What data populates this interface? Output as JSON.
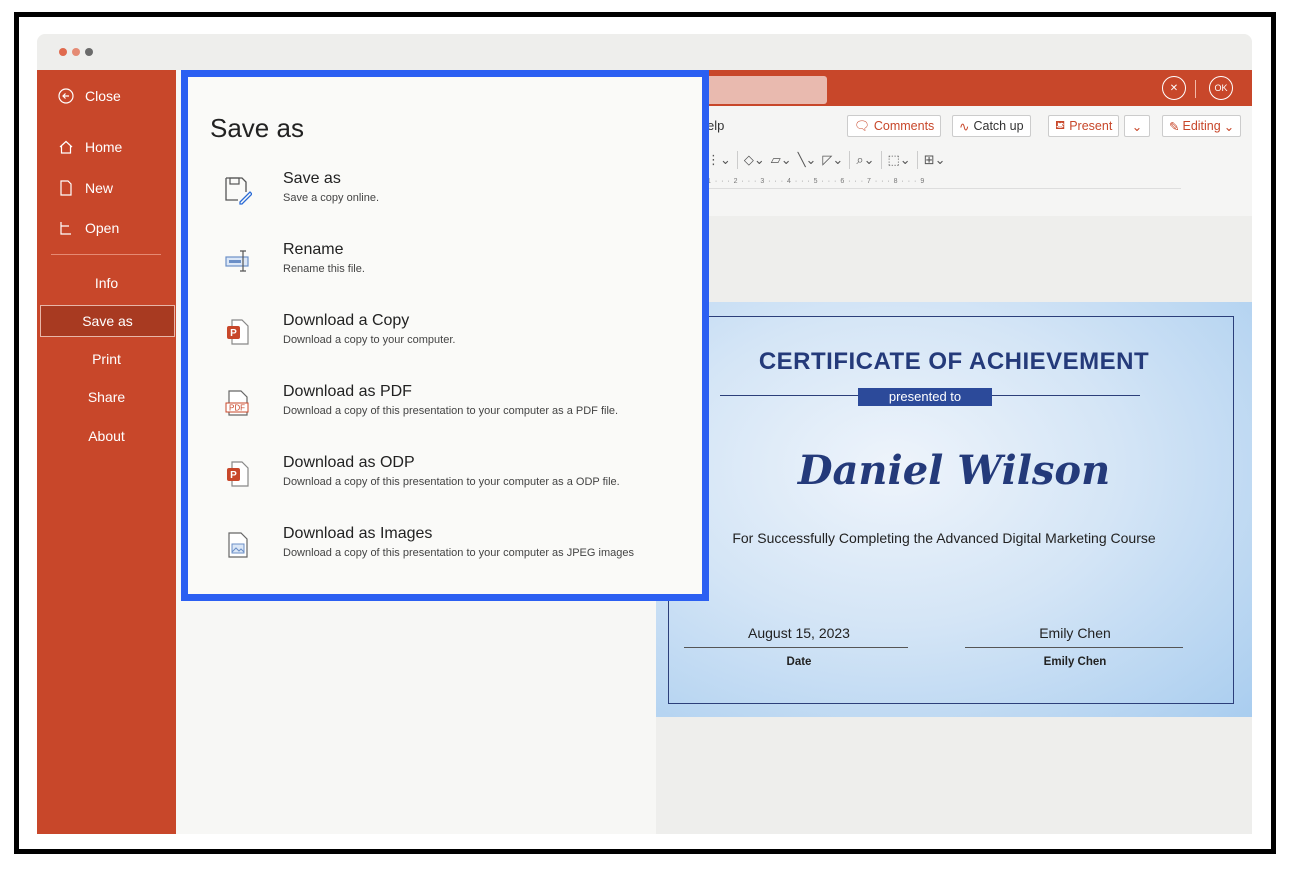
{
  "colors": {
    "accent": "#c8472a",
    "active": "#a83a21",
    "highlight": "#2b5ff2",
    "cert_blue": "#243a7a"
  },
  "sidebar": {
    "items": [
      {
        "label": "Close",
        "icon": "back-arrow-icon"
      },
      {
        "label": "Home",
        "icon": "home-icon"
      },
      {
        "label": "New",
        "icon": "new-file-icon"
      },
      {
        "label": "Open",
        "icon": "open-folder-icon"
      },
      {
        "label": "Info"
      },
      {
        "label": "Save as",
        "active": true
      },
      {
        "label": "Print"
      },
      {
        "label": "Share"
      },
      {
        "label": "About"
      }
    ]
  },
  "save_panel": {
    "title": "Save as",
    "options": [
      {
        "title": "Save as",
        "desc": "Save a copy online.",
        "icon": "save-as-icon"
      },
      {
        "title": "Rename",
        "desc": "Rename this file.",
        "icon": "rename-icon"
      },
      {
        "title": "Download a Copy",
        "desc": "Download a copy to your computer.",
        "icon": "powerpoint-file-icon"
      },
      {
        "title": "Download as PDF",
        "desc": "Download a copy of this presentation to your computer as a PDF file.",
        "icon": "pdf-file-icon"
      },
      {
        "title": "Download as ODP",
        "desc": "Download a copy of this presentation to your computer as a ODP file.",
        "icon": "odp-file-icon"
      },
      {
        "title": "Download as Images",
        "desc": "Download a copy of this presentation to your computer as JPEG images",
        "icon": "image-file-icon"
      }
    ]
  },
  "topbar": {
    "close_label": "✕",
    "ok_label": "OK"
  },
  "ribbon": {
    "menu_partial": "elp",
    "comments": "Comments",
    "catch_up": "Catch up",
    "present": "Present",
    "editing": "Editing",
    "ruler_text": "1 · · · 2 · · · 3 · · · 4 · · · 5 · · · 6 · · · 7 · · · 8 · · · 9"
  },
  "certificate": {
    "title": "CERTIFICATE OF ACHIEVEMENT",
    "presented_to": "presented to",
    "name": "Daniel Wilson",
    "subtitle": "For Successfully Completing the Advanced Digital Marketing Course",
    "date_value": "August 15, 2023",
    "date_label": "Date",
    "signer_value": "Emily Chen",
    "signer_label": "Emily Chen"
  }
}
